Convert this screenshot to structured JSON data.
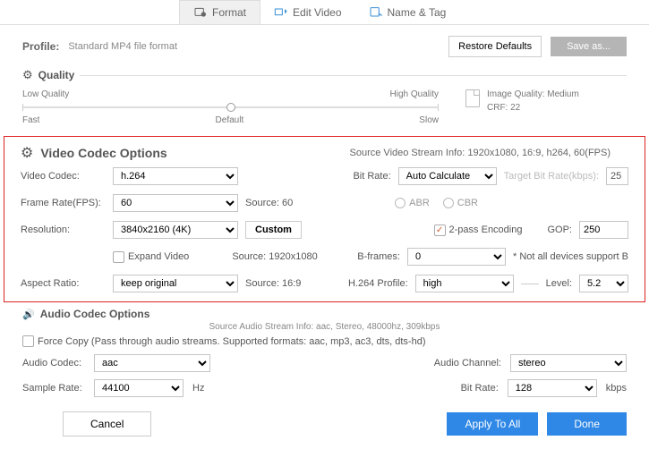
{
  "tabs": {
    "format": "Format",
    "edit": "Edit Video",
    "name": "Name & Tag"
  },
  "profile": {
    "label": "Profile:",
    "value": "Standard MP4 file format",
    "restore": "Restore Defaults",
    "saveas": "Save as..."
  },
  "quality": {
    "title": "Quality",
    "low": "Low Quality",
    "high": "High Quality",
    "fast": "Fast",
    "default": "Default",
    "slow": "Slow",
    "img_q": "Image Quality: Medium",
    "crf": "CRF: 22"
  },
  "video": {
    "title": "Video Codec Options",
    "source_info": "Source Video Stream Info: 1920x1080, 16:9, h264, 60(FPS)",
    "codec_label": "Video Codec:",
    "codec": "h.264",
    "bitrate_label": "Bit Rate:",
    "bitrate": "Auto Calculate",
    "target_label": "Target Bit Rate(kbps):",
    "target_value": "25",
    "fps_label": "Frame Rate(FPS):",
    "fps": "60",
    "fps_src": "Source: 60",
    "abr": "ABR",
    "cbr": "CBR",
    "res_label": "Resolution:",
    "res": "3840x2160 (4K)",
    "custom": "Custom",
    "expand": "Expand Video",
    "res_src": "Source: 1920x1080",
    "twopass": "2-pass Encoding",
    "gop_label": "GOP:",
    "gop": "250",
    "bframes_label": "B-frames:",
    "bframes": "0",
    "bframes_note": "* Not all devices support B",
    "ar_label": "Aspect Ratio:",
    "ar": "keep original",
    "ar_src": "Source: 16:9",
    "profile_label": "H.264 Profile:",
    "profile": "high",
    "level_label": "Level:",
    "level": "5.2"
  },
  "audio": {
    "title": "Audio Codec Options",
    "source_info": "Source Audio Stream Info: aac, Stereo, 48000hz, 309kbps",
    "force": "Force Copy (Pass through audio streams. Supported formats: aac, mp3, ac3, dts, dts-hd)",
    "codec_label": "Audio Codec:",
    "codec": "aac",
    "channel_label": "Audio Channel:",
    "channel": "stereo",
    "rate_label": "Sample Rate:",
    "rate": "44100",
    "hz": "Hz",
    "bitrate_label": "Bit Rate:",
    "bitrate": "128",
    "kbps": "kbps"
  },
  "footer": {
    "cancel": "Cancel",
    "apply": "Apply To All",
    "done": "Done"
  }
}
